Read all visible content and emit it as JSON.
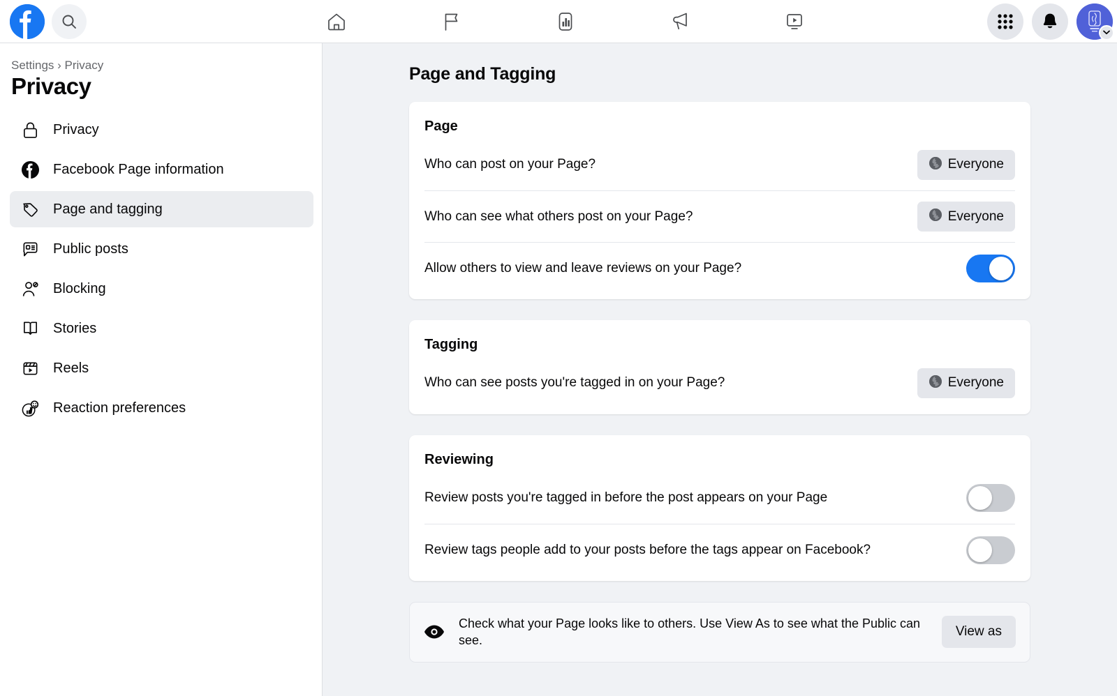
{
  "topbar": {
    "logo_name": "facebook-logo",
    "search_placeholder": "Search Facebook",
    "nav_tabs": [
      {
        "icon": "home-icon",
        "label": "Home"
      },
      {
        "icon": "flag-icon",
        "label": "Pages"
      },
      {
        "icon": "insights-icon",
        "label": "Insights"
      },
      {
        "icon": "megaphone-icon",
        "label": "Ads"
      },
      {
        "icon": "video-icon",
        "label": "Video"
      }
    ],
    "menu_label": "Menu",
    "notifications_label": "Notifications",
    "avatar_label": "Your profile"
  },
  "sidebar": {
    "breadcrumb": "Settings › Privacy",
    "title": "Privacy",
    "items": [
      {
        "label": "Privacy",
        "icon": "lock-icon",
        "active": false
      },
      {
        "label": "Facebook Page information",
        "icon": "facebook-circle-icon",
        "active": false
      },
      {
        "label": "Page and tagging",
        "icon": "tag-icon",
        "active": true
      },
      {
        "label": "Public posts",
        "icon": "comment-icon",
        "active": false
      },
      {
        "label": "Blocking",
        "icon": "user-block-icon",
        "active": false
      },
      {
        "label": "Stories",
        "icon": "book-icon",
        "active": false
      },
      {
        "label": "Reels",
        "icon": "reels-icon",
        "active": false
      },
      {
        "label": "Reaction preferences",
        "icon": "thumbs-up-icon",
        "active": false
      }
    ]
  },
  "main": {
    "heading": "Page and Tagging",
    "cards": [
      {
        "title": "Page",
        "rows": [
          {
            "label": "Who can post on your Page?",
            "control": "pill",
            "value": "Everyone"
          },
          {
            "label": "Who can see what others post on your Page?",
            "control": "pill",
            "value": "Everyone"
          },
          {
            "label": "Allow others to view and leave reviews on your Page?",
            "control": "toggle",
            "value": "on"
          }
        ]
      },
      {
        "title": "Tagging",
        "rows": [
          {
            "label": "Who can see posts you're tagged in on your Page?",
            "control": "pill",
            "value": "Everyone"
          }
        ]
      },
      {
        "title": "Reviewing",
        "rows": [
          {
            "label": "Review posts you're tagged in before the post appears on your Page",
            "control": "toggle",
            "value": "off"
          },
          {
            "label": "Review tags people add to your posts before the tags appear on Facebook?",
            "control": "toggle",
            "value": "off"
          }
        ]
      }
    ],
    "notice": {
      "icon": "eye-icon",
      "text": "Check what your Page looks like to others. Use View As to see what the Public can see.",
      "button_label": "View as"
    }
  },
  "colors": {
    "brand_blue": "#1877F2",
    "page_bg": "#F0F2F5",
    "card_bg": "#FFFFFF",
    "pill_bg": "#E4E6EB",
    "toggle_off": "#C9CCD1",
    "text_primary": "#080809",
    "text_secondary": "#65676B",
    "avatar_bg": "#5061D8"
  }
}
